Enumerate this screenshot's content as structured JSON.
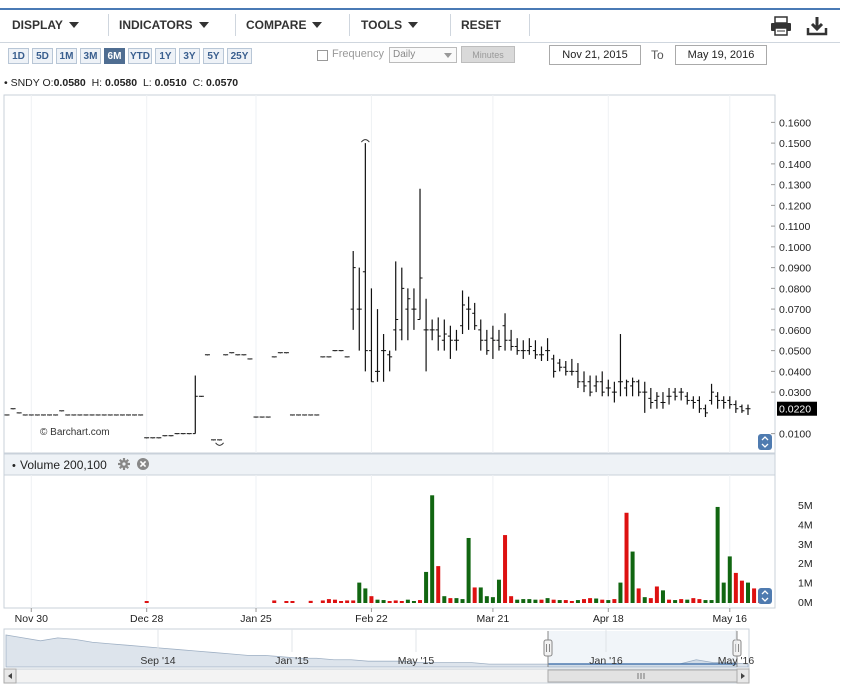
{
  "toolbar": {
    "display": "DISPLAY",
    "indicators": "INDICATORS",
    "compare": "COMPARE",
    "tools": "TOOLS",
    "reset": "RESET",
    "print_icon": "printer-icon",
    "download_icon": "download-icon"
  },
  "ranges": [
    "1D",
    "5D",
    "1M",
    "3M",
    "6M",
    "YTD",
    "1Y",
    "3Y",
    "5Y",
    "25Y"
  ],
  "active_range": "6M",
  "frequency": {
    "label": "Frequency",
    "selected": "Daily",
    "minutes_label": "Minutes",
    "checked": false
  },
  "date_range": {
    "from": "Nov 21, 2015",
    "to_label": "To",
    "to": "May 19, 2016"
  },
  "ohlc": {
    "symbol": "SNDY",
    "o_label": "O:",
    "open": "0.0580",
    "h_label": "H:",
    "high": "0.0580",
    "l_label": "L:",
    "low": "0.0510",
    "c_label": "C:",
    "close": "0.0570"
  },
  "watermark": "© Barchart.com",
  "volume_panel": {
    "title": "Volume 200,100"
  },
  "colors": {
    "up": "#116611",
    "down": "#dd1111",
    "accent": "#4f6d91",
    "last_price_bg": "#000000"
  },
  "chart_data": [
    {
      "type": "ohlc",
      "title": "",
      "y_ticks": [
        "0.1600",
        "0.1500",
        "0.1400",
        "0.1300",
        "0.1200",
        "0.1100",
        "0.1000",
        "0.0900",
        "0.0800",
        "0.0700",
        "0.0600",
        "0.0500",
        "0.0400",
        "0.0300",
        "0.0100"
      ],
      "ylim": [
        0.005,
        0.165
      ],
      "last_price": "0.0220",
      "x_ticks": [
        "Nov 30",
        "Dec 28",
        "Jan 25",
        "Feb 22",
        "Mar 21",
        "Apr 18",
        "May 16"
      ],
      "dates": [
        "2015-11-23",
        "2015-11-24",
        "2015-11-25",
        "2015-11-27",
        "2015-11-30",
        "2015-12-01",
        "2015-12-02",
        "2015-12-03",
        "2015-12-04",
        "2015-12-07",
        "2015-12-08",
        "2015-12-09",
        "2015-12-10",
        "2015-12-11",
        "2015-12-14",
        "2015-12-15",
        "2015-12-16",
        "2015-12-17",
        "2015-12-18",
        "2015-12-21",
        "2015-12-22",
        "2015-12-23",
        "2015-12-24",
        "2015-12-28",
        "2015-12-29",
        "2015-12-30",
        "2015-12-31",
        "2016-01-04",
        "2016-01-05",
        "2016-01-06",
        "2016-01-07",
        "2016-01-08",
        "2016-01-11",
        "2016-01-12",
        "2016-01-13",
        "2016-01-14",
        "2016-01-15",
        "2016-01-19",
        "2016-01-20",
        "2016-01-21",
        "2016-01-22",
        "2016-01-25",
        "2016-01-26",
        "2016-01-27",
        "2016-01-28",
        "2016-01-29",
        "2016-02-01",
        "2016-02-02",
        "2016-02-03",
        "2016-02-04",
        "2016-02-05",
        "2016-02-08",
        "2016-02-09",
        "2016-02-10",
        "2016-02-11",
        "2016-02-12",
        "2016-02-16",
        "2016-02-17",
        "2016-02-18",
        "2016-02-19",
        "2016-02-22",
        "2016-02-23",
        "2016-02-24",
        "2016-02-25",
        "2016-02-26",
        "2016-02-29",
        "2016-03-01",
        "2016-03-02",
        "2016-03-03",
        "2016-03-04",
        "2016-03-07",
        "2016-03-08",
        "2016-03-09",
        "2016-03-10",
        "2016-03-11",
        "2016-03-14",
        "2016-03-15",
        "2016-03-16",
        "2016-03-17",
        "2016-03-18",
        "2016-03-21",
        "2016-03-22",
        "2016-03-23",
        "2016-03-24",
        "2016-03-28",
        "2016-03-29",
        "2016-03-30",
        "2016-03-31",
        "2016-04-01",
        "2016-04-04",
        "2016-04-05",
        "2016-04-06",
        "2016-04-07",
        "2016-04-08",
        "2016-04-11",
        "2016-04-12",
        "2016-04-13",
        "2016-04-14",
        "2016-04-15",
        "2016-04-18",
        "2016-04-19",
        "2016-04-20",
        "2016-04-21",
        "2016-04-22",
        "2016-04-25",
        "2016-04-26",
        "2016-04-27",
        "2016-04-28",
        "2016-04-29",
        "2016-05-02",
        "2016-05-03",
        "2016-05-04",
        "2016-05-05",
        "2016-05-06",
        "2016-05-09",
        "2016-05-10",
        "2016-05-11",
        "2016-05-12",
        "2016-05-13",
        "2016-05-16",
        "2016-05-17",
        "2016-05-18",
        "2016-05-19"
      ],
      "ohlc": [
        [
          0.019,
          0.019,
          0.019,
          0.019
        ],
        [
          0.022,
          0.022,
          0.022,
          0.022
        ],
        [
          0.02,
          0.02,
          0.02,
          0.02
        ],
        [
          0.019,
          0.019,
          0.019,
          0.019
        ],
        [
          0.019,
          0.019,
          0.019,
          0.019
        ],
        [
          0.019,
          0.019,
          0.019,
          0.019
        ],
        [
          0.019,
          0.019,
          0.019,
          0.019
        ],
        [
          0.019,
          0.019,
          0.019,
          0.019
        ],
        [
          0.019,
          0.019,
          0.019,
          0.019
        ],
        [
          0.021,
          0.021,
          0.021,
          0.021
        ],
        [
          0.019,
          0.019,
          0.019,
          0.019
        ],
        [
          0.019,
          0.019,
          0.019,
          0.019
        ],
        [
          0.019,
          0.019,
          0.019,
          0.019
        ],
        [
          0.019,
          0.019,
          0.019,
          0.019
        ],
        [
          0.019,
          0.019,
          0.019,
          0.019
        ],
        [
          0.019,
          0.019,
          0.019,
          0.019
        ],
        [
          0.019,
          0.019,
          0.019,
          0.019
        ],
        [
          0.019,
          0.019,
          0.019,
          0.019
        ],
        [
          0.019,
          0.019,
          0.019,
          0.019
        ],
        [
          0.019,
          0.019,
          0.019,
          0.019
        ],
        [
          0.019,
          0.019,
          0.019,
          0.019
        ],
        [
          0.019,
          0.019,
          0.019,
          0.019
        ],
        [
          0.019,
          0.019,
          0.019,
          0.019
        ],
        [
          0.008,
          0.008,
          0.008,
          0.008
        ],
        [
          0.008,
          0.008,
          0.008,
          0.008
        ],
        [
          0.008,
          0.008,
          0.008,
          0.008
        ],
        [
          0.009,
          0.009,
          0.009,
          0.009
        ],
        [
          0.009,
          0.009,
          0.009,
          0.009
        ],
        [
          0.01,
          0.01,
          0.01,
          0.01
        ],
        [
          0.01,
          0.01,
          0.01,
          0.01
        ],
        [
          0.01,
          0.01,
          0.01,
          0.01
        ],
        [
          0.01,
          0.038,
          0.01,
          0.028
        ],
        [
          0.028,
          0.028,
          0.028,
          0.028
        ],
        [
          0.048,
          0.048,
          0.048,
          0.048
        ],
        [
          0.007,
          0.007,
          0.007,
          0.007
        ],
        [
          0.007,
          0.007,
          0.007,
          0.007
        ],
        [
          0.048,
          0.048,
          0.048,
          0.048
        ],
        [
          0.049,
          0.049,
          0.049,
          0.049
        ],
        [
          0.048,
          0.048,
          0.048,
          0.048
        ],
        [
          0.048,
          0.048,
          0.048,
          0.048
        ],
        [
          0.046,
          0.046,
          0.046,
          0.046
        ],
        [
          0.018,
          0.018,
          0.018,
          0.018
        ],
        [
          0.018,
          0.018,
          0.018,
          0.018
        ],
        [
          0.018,
          0.018,
          0.018,
          0.018
        ],
        [
          0.047,
          0.047,
          0.047,
          0.047
        ],
        [
          0.049,
          0.049,
          0.049,
          0.049
        ],
        [
          0.049,
          0.049,
          0.049,
          0.049
        ],
        [
          0.019,
          0.019,
          0.019,
          0.019
        ],
        [
          0.019,
          0.019,
          0.019,
          0.019
        ],
        [
          0.019,
          0.019,
          0.019,
          0.019
        ],
        [
          0.019,
          0.019,
          0.019,
          0.019
        ],
        [
          0.019,
          0.019,
          0.019,
          0.019
        ],
        [
          0.047,
          0.047,
          0.047,
          0.047
        ],
        [
          0.047,
          0.047,
          0.047,
          0.047
        ],
        [
          0.05,
          0.05,
          0.05,
          0.05
        ],
        [
          0.05,
          0.05,
          0.05,
          0.05
        ],
        [
          0.047,
          0.047,
          0.047,
          0.047
        ],
        [
          0.07,
          0.098,
          0.06,
          0.09
        ],
        [
          0.07,
          0.09,
          0.05,
          0.07
        ],
        [
          0.088,
          0.15,
          0.04,
          0.05
        ],
        [
          0.05,
          0.08,
          0.035,
          0.035
        ],
        [
          0.04,
          0.07,
          0.035,
          0.04
        ],
        [
          0.05,
          0.058,
          0.035,
          0.05
        ],
        [
          0.048,
          0.05,
          0.04,
          0.047
        ],
        [
          0.06,
          0.093,
          0.05,
          0.065
        ],
        [
          0.06,
          0.09,
          0.055,
          0.08
        ],
        [
          0.07,
          0.08,
          0.055,
          0.075
        ],
        [
          0.07,
          0.08,
          0.06,
          0.07
        ],
        [
          0.065,
          0.128,
          0.065,
          0.085
        ],
        [
          0.06,
          0.075,
          0.04,
          0.06
        ],
        [
          0.06,
          0.065,
          0.055,
          0.06
        ],
        [
          0.06,
          0.066,
          0.05,
          0.057
        ],
        [
          0.055,
          0.065,
          0.05,
          0.058
        ],
        [
          0.057,
          0.062,
          0.046,
          0.055
        ],
        [
          0.055,
          0.06,
          0.05,
          0.055
        ],
        [
          0.062,
          0.079,
          0.058,
          0.072
        ],
        [
          0.07,
          0.076,
          0.06,
          0.07
        ],
        [
          0.068,
          0.073,
          0.06,
          0.062
        ],
        [
          0.06,
          0.065,
          0.05,
          0.055
        ],
        [
          0.055,
          0.06,
          0.048,
          0.05
        ],
        [
          0.056,
          0.062,
          0.046,
          0.055
        ],
        [
          0.055,
          0.06,
          0.05,
          0.052
        ],
        [
          0.062,
          0.068,
          0.05,
          0.055
        ],
        [
          0.055,
          0.06,
          0.05,
          0.052
        ],
        [
          0.052,
          0.056,
          0.048,
          0.05
        ],
        [
          0.05,
          0.055,
          0.046,
          0.05
        ],
        [
          0.05,
          0.056,
          0.048,
          0.052
        ],
        [
          0.05,
          0.055,
          0.046,
          0.048
        ],
        [
          0.048,
          0.052,
          0.045,
          0.048
        ],
        [
          0.05,
          0.056,
          0.045,
          0.05
        ],
        [
          0.046,
          0.048,
          0.037,
          0.04
        ],
        [
          0.044,
          0.046,
          0.04,
          0.042
        ],
        [
          0.042,
          0.045,
          0.038,
          0.04
        ],
        [
          0.04,
          0.046,
          0.038,
          0.04
        ],
        [
          0.04,
          0.044,
          0.032,
          0.035
        ],
        [
          0.035,
          0.04,
          0.03,
          0.033
        ],
        [
          0.035,
          0.038,
          0.028,
          0.03
        ],
        [
          0.033,
          0.038,
          0.03,
          0.035
        ],
        [
          0.035,
          0.04,
          0.028,
          0.03
        ],
        [
          0.032,
          0.036,
          0.028,
          0.032
        ],
        [
          0.03,
          0.035,
          0.025,
          0.03
        ],
        [
          0.035,
          0.058,
          0.028,
          0.035
        ],
        [
          0.032,
          0.036,
          0.028,
          0.035
        ],
        [
          0.033,
          0.037,
          0.028,
          0.035
        ],
        [
          0.035,
          0.036,
          0.028,
          0.03
        ],
        [
          0.03,
          0.035,
          0.02,
          0.03
        ],
        [
          0.027,
          0.032,
          0.022,
          0.025
        ],
        [
          0.026,
          0.03,
          0.022,
          0.028
        ],
        [
          0.025,
          0.03,
          0.022,
          0.025
        ],
        [
          0.028,
          0.032,
          0.024,
          0.028
        ],
        [
          0.03,
          0.032,
          0.026,
          0.028
        ],
        [
          0.03,
          0.032,
          0.026,
          0.03
        ],
        [
          0.028,
          0.03,
          0.024,
          0.026
        ],
        [
          0.026,
          0.028,
          0.022,
          0.025
        ],
        [
          0.026,
          0.028,
          0.02,
          0.022
        ],
        [
          0.022,
          0.024,
          0.018,
          0.02
        ],
        [
          0.026,
          0.034,
          0.024,
          0.03
        ],
        [
          0.028,
          0.03,
          0.022,
          0.026
        ],
        [
          0.026,
          0.028,
          0.022,
          0.025
        ],
        [
          0.026,
          0.028,
          0.022,
          0.024
        ],
        [
          0.024,
          0.026,
          0.02,
          0.022
        ],
        [
          0.023,
          0.024,
          0.02,
          0.021
        ],
        [
          0.022,
          0.024,
          0.019,
          0.022
        ]
      ],
      "swing_marks": [
        {
          "date": "2016-02-19",
          "kind": "high",
          "value": 0.15
        },
        {
          "date": "2016-01-14",
          "kind": "low",
          "value": 0.007
        }
      ]
    },
    {
      "type": "bar",
      "title": "Volume 200,100",
      "y_ticks": [
        "5M",
        "4M",
        "3M",
        "2M",
        "1M",
        "0M"
      ],
      "ylim": [
        0,
        5.5
      ],
      "unit": "M",
      "volumes": [
        0,
        0,
        0,
        0,
        0,
        0,
        0,
        0,
        0,
        0,
        0,
        0,
        0,
        0,
        0,
        0,
        0,
        0,
        0,
        0,
        0,
        0,
        0,
        0.05,
        0,
        0,
        0,
        0,
        0,
        0,
        0,
        0,
        0,
        0,
        0,
        0,
        0,
        0,
        0,
        0,
        0,
        0,
        0,
        0,
        0.08,
        0,
        0.05,
        0.05,
        0,
        0,
        0.06,
        0,
        0.08,
        0.15,
        0.12,
        0.05,
        0.08,
        0.08,
        1,
        0.7,
        0.3,
        0.12,
        0.1,
        0.05,
        0.08,
        0.05,
        0.12,
        0.05,
        0.1,
        1.55,
        5.5,
        1.85,
        0.3,
        0.2,
        0.2,
        0.15,
        3.3,
        0.75,
        0.75,
        0.3,
        0.25,
        1.15,
        3.45,
        0.3,
        0.12,
        0.15,
        0.15,
        0.12,
        0.12,
        0.2,
        0.12,
        0.1,
        0.1,
        0.05,
        0.1,
        0.15,
        0.2,
        0.18,
        0.12,
        0.1,
        0.15,
        1,
        4.6,
        2.6,
        0.7,
        0.25,
        0.2,
        0.8,
        0.6,
        0.12,
        0.1,
        0.15,
        0.12,
        0.2,
        0.15,
        0.1,
        0.1,
        4.9,
        1,
        2.35,
        1.5,
        1.1,
        1,
        0.7,
        0.1
      ],
      "up": [
        false,
        false,
        false,
        false,
        false,
        false,
        false,
        false,
        false,
        false,
        false,
        false,
        false,
        false,
        false,
        false,
        false,
        false,
        false,
        false,
        false,
        false,
        false,
        false,
        false,
        false,
        false,
        false,
        false,
        false,
        false,
        false,
        false,
        false,
        false,
        false,
        false,
        false,
        false,
        false,
        false,
        false,
        false,
        false,
        false,
        false,
        false,
        false,
        false,
        false,
        false,
        false,
        false,
        false,
        false,
        false,
        false,
        false,
        true,
        true,
        false,
        true,
        true,
        false,
        false,
        false,
        true,
        true,
        false,
        true,
        true,
        false,
        true,
        false,
        true,
        true,
        true,
        false,
        true,
        true,
        true,
        true,
        false,
        false,
        true,
        true,
        true,
        true,
        false,
        true,
        false,
        true,
        false,
        false,
        true,
        false,
        false,
        true,
        false,
        true,
        false,
        true,
        false,
        true,
        false,
        true,
        false,
        false,
        true,
        false,
        true,
        false,
        true,
        false,
        false,
        true,
        true,
        true,
        true,
        true,
        false,
        false,
        true
      ]
    },
    {
      "type": "area",
      "title": "",
      "x_ticks": [
        "Sep '14",
        "Jan '15",
        "May '15",
        "Jan '16",
        "May '16"
      ],
      "values": [
        0.22,
        0.2,
        0.18,
        0.2,
        0.19,
        0.17,
        0.16,
        0.15,
        0.14,
        0.13,
        0.12,
        0.11,
        0.1,
        0.09,
        0.08,
        0.08,
        0.07,
        0.06,
        0.06,
        0.05,
        0.05,
        0.04,
        0.04,
        0.04,
        0.03,
        0.03,
        0.03,
        0.03,
        0.02,
        0.02,
        0.02,
        0.02,
        0.02,
        0.02,
        0.02,
        0.02,
        0.02,
        0.02,
        0.02,
        0.02,
        0.05,
        0.03,
        0.03,
        0.02
      ]
    }
  ]
}
